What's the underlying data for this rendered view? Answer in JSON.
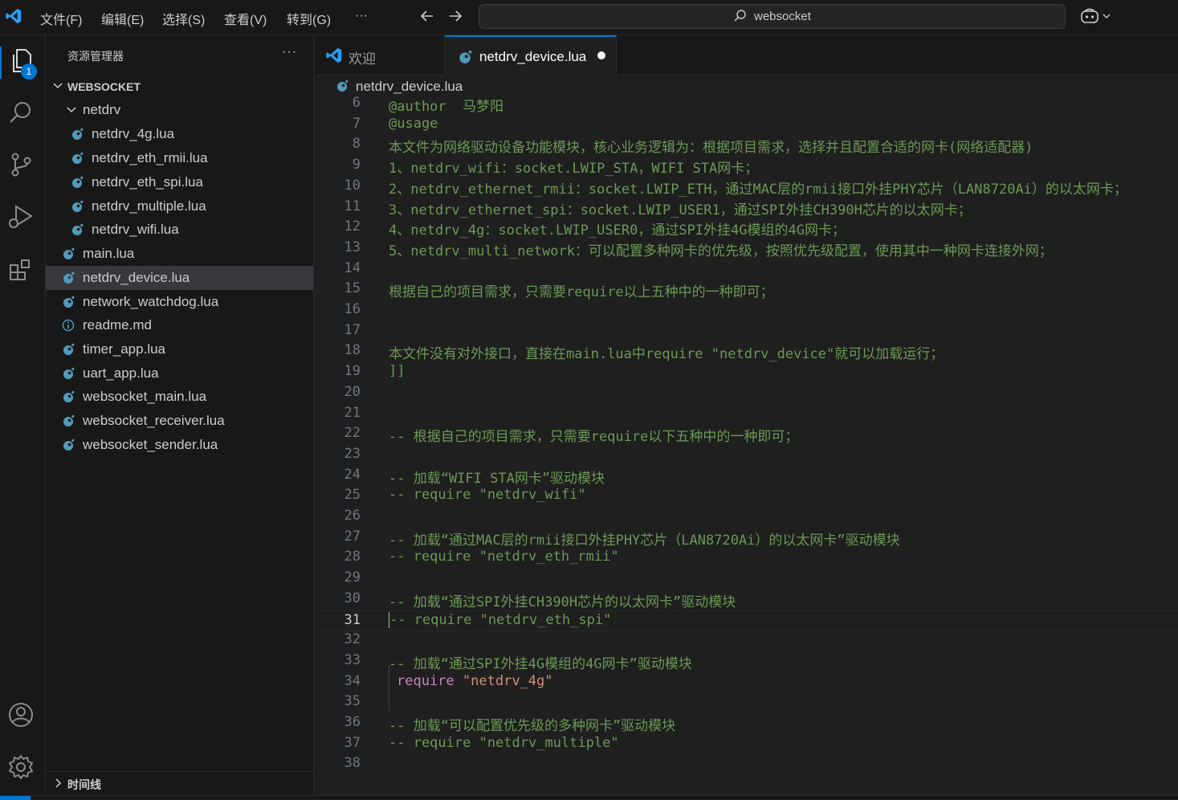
{
  "menu": [
    "文件(F)",
    "编辑(E)",
    "选择(S)",
    "查看(V)",
    "转到(G)",
    "···"
  ],
  "search": {
    "text": "websocket"
  },
  "activity": {
    "explorer_badge": "1"
  },
  "sidebar": {
    "title": "资源管理器",
    "more": "···",
    "workspace": "WEBSOCKET",
    "folder": "netdrv",
    "folder_files": [
      "netdrv_4g.lua",
      "netdrv_eth_rmii.lua",
      "netdrv_eth_spi.lua",
      "netdrv_multiple.lua",
      "netdrv_wifi.lua"
    ],
    "root_files": [
      "main.lua",
      "netdrv_device.lua",
      "network_watchdog.lua",
      "readme.md",
      "timer_app.lua",
      "uart_app.lua",
      "websocket_main.lua",
      "websocket_receiver.lua",
      "websocket_sender.lua"
    ],
    "timeline_label": "时间线"
  },
  "tabs": [
    {
      "label": "欢迎"
    },
    {
      "label": "netdrv_device.lua"
    }
  ],
  "breadcrumb": "netdrv_device.lua",
  "editor": {
    "lines": [
      {
        "num": "6",
        "text": "@author  马梦阳"
      },
      {
        "num": "7",
        "text": "@usage"
      },
      {
        "num": "8",
        "text": "本文件为网络驱动设备功能模块，核心业务逻辑为：根据项目需求，选择并且配置合适的网卡(网络适配器)"
      },
      {
        "num": "9",
        "text": "1、netdrv_wifi：socket.LWIP_STA，WIFI STA网卡；"
      },
      {
        "num": "10",
        "text": "2、netdrv_ethernet_rmii：socket.LWIP_ETH，通过MAC层的rmii接口外挂PHY芯片（LAN8720Ai）的以太网卡；"
      },
      {
        "num": "11",
        "text": "3、netdrv_ethernet_spi：socket.LWIP_USER1，通过SPI外挂CH390H芯片的以太网卡；"
      },
      {
        "num": "12",
        "text": "4、netdrv_4g：socket.LWIP_USER0，通过SPI外挂4G模组的4G网卡；"
      },
      {
        "num": "13",
        "text": "5、netdrv_multi_network：可以配置多种网卡的优先级，按照优先级配置，使用其中一种网卡连接外网；"
      },
      {
        "num": "14",
        "text": ""
      },
      {
        "num": "15",
        "text": "根据自己的项目需求，只需要require以上五种中的一种即可；"
      },
      {
        "num": "16",
        "text": ""
      },
      {
        "num": "17",
        "text": ""
      },
      {
        "num": "18",
        "text": "本文件没有对外接口，直接在main.lua中require \"netdrv_device\"就可以加载运行；"
      },
      {
        "num": "19",
        "text": "]]"
      },
      {
        "num": "20",
        "text": ""
      },
      {
        "num": "21",
        "text": ""
      },
      {
        "num": "22",
        "text": "-- 根据自己的项目需求，只需要require以下五种中的一种即可；"
      },
      {
        "num": "23",
        "text": ""
      },
      {
        "num": "24",
        "text": "-- 加载“WIFI STA网卡”驱动模块"
      },
      {
        "num": "25",
        "text": "-- require \"netdrv_wifi\""
      },
      {
        "num": "26",
        "text": ""
      },
      {
        "num": "27",
        "text": "-- 加载“通过MAC层的rmii接口外挂PHY芯片（LAN8720Ai）的以太网卡”驱动模块"
      },
      {
        "num": "28",
        "text": "-- require \"netdrv_eth_rmii\""
      },
      {
        "num": "29",
        "text": ""
      },
      {
        "num": "30",
        "text": "-- 加载“通过SPI外挂CH390H芯片的以太网卡”驱动模块"
      },
      {
        "num": "31",
        "text": "-- require \"netdrv_eth_spi\""
      },
      {
        "num": "32",
        "text": ""
      },
      {
        "num": "33",
        "text": "-- 加载“通过SPI外挂4G模组的4G网卡”驱动模块"
      },
      {
        "num": "34",
        "text": "",
        "kw": "require",
        "str": "\"netdrv_4g\""
      },
      {
        "num": "35",
        "text": ""
      },
      {
        "num": "36",
        "text": "-- 加载“可以配置优先级的多种网卡”驱动模块"
      },
      {
        "num": "37",
        "text": "-- require \"netdrv_multiple\""
      },
      {
        "num": "38",
        "text": ""
      }
    ]
  },
  "colors": {
    "accent": "#0078d4",
    "comment": "#6a9955",
    "keyword": "#c586c0",
    "string": "#ce9178",
    "lua_icon": "#519aba"
  }
}
